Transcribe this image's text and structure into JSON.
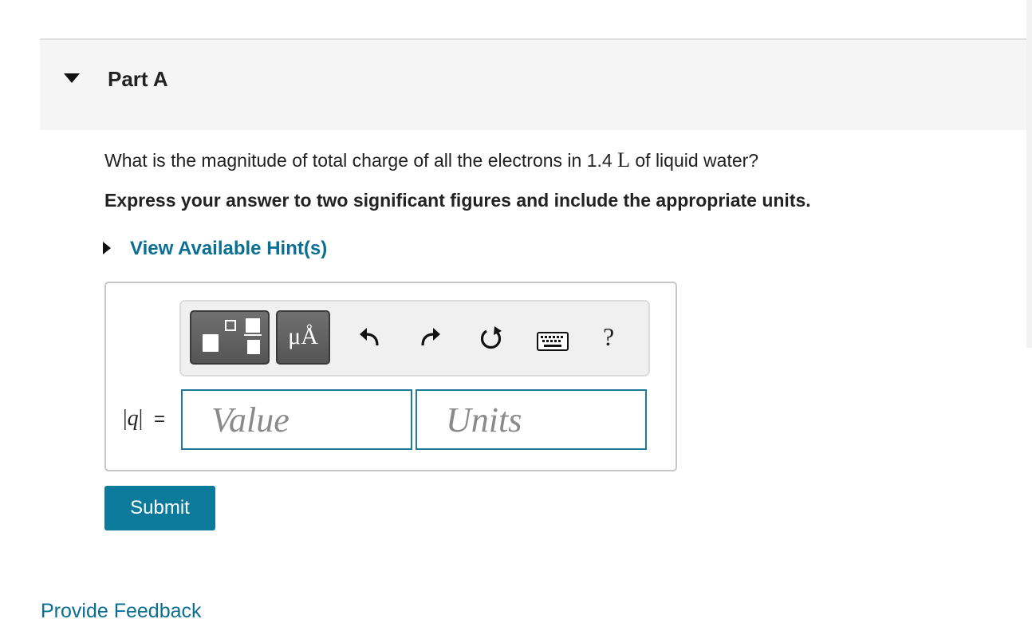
{
  "part": {
    "title": "Part A"
  },
  "question": {
    "text_before": "What is the magnitude of total charge of all the electrons in 1.4 ",
    "unit_symbol": "L",
    "text_after": " of liquid water?",
    "instruction": "Express your answer to two significant figures and include the appropriate units."
  },
  "hints": {
    "link_label": "View Available Hint(s)"
  },
  "toolbar": {
    "units_button_label": "μÅ",
    "help_label": "?",
    "icons": [
      "templates-icon",
      "units-icon",
      "undo-icon",
      "redo-icon",
      "reset-icon",
      "keyboard-icon",
      "help-icon"
    ]
  },
  "answer": {
    "variable": "q",
    "equals": "=",
    "value_placeholder": "Value",
    "units_placeholder": "Units"
  },
  "actions": {
    "submit_label": "Submit",
    "feedback_label": "Provide Feedback"
  },
  "colors": {
    "accent": "#0a6f93",
    "submit_bg": "#0c7a9b",
    "input_border": "#1f7a9a",
    "header_bg": "#f5f5f5"
  }
}
